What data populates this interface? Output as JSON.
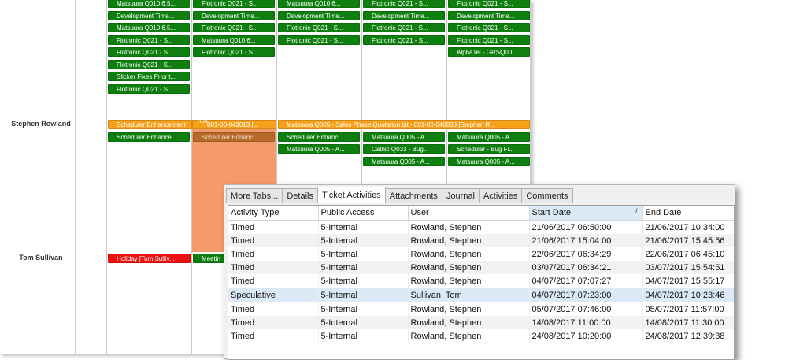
{
  "schedule": {
    "people": [
      {
        "name": "Stephen Rowland"
      },
      {
        "name": "Tom Sullivan"
      }
    ],
    "top_events": [
      {
        "col": 0,
        "row": 0,
        "text": "Matsuura Q010 6.5..."
      },
      {
        "col": 0,
        "row": 1,
        "text": "Development Time..."
      },
      {
        "col": 0,
        "row": 2,
        "text": "Matsuura Q010 6.5..."
      },
      {
        "col": 0,
        "row": 3,
        "text": "Flotronic Q021 - S..."
      },
      {
        "col": 0,
        "row": 4,
        "text": "Flotronic Q021 - S..."
      },
      {
        "col": 0,
        "row": 5,
        "text": "Flotronic Q021 - S..."
      },
      {
        "col": 0,
        "row": 6,
        "text": "Slicker Fixes Priorit..."
      },
      {
        "col": 0,
        "row": 7,
        "text": "Flotronic Q021 - S..."
      },
      {
        "col": 1,
        "row": 0,
        "text": "Flotronic Q021 - S..."
      },
      {
        "col": 1,
        "row": 1,
        "text": "Development Time..."
      },
      {
        "col": 1,
        "row": 2,
        "text": "Flotronic Q021 - S..."
      },
      {
        "col": 1,
        "row": 3,
        "text": "Matsuura Q010 6..."
      },
      {
        "col": 1,
        "row": 4,
        "text": "Flotronic Q021 - S..."
      },
      {
        "col": 2,
        "row": 0,
        "text": "Matsuura Q010 6..."
      },
      {
        "col": 2,
        "row": 1,
        "text": "Development Time..."
      },
      {
        "col": 2,
        "row": 2,
        "text": "Flotronic Q021 - S..."
      },
      {
        "col": 2,
        "row": 3,
        "text": "Flotronic Q021 - S..."
      },
      {
        "col": 3,
        "row": 0,
        "text": "Flotronic Q021 - S..."
      },
      {
        "col": 3,
        "row": 1,
        "text": "Development Time..."
      },
      {
        "col": 3,
        "row": 2,
        "text": "Flotronic Q021 - S..."
      },
      {
        "col": 3,
        "row": 3,
        "text": "Flotronic Q021 - S..."
      },
      {
        "col": 4,
        "row": 0,
        "text": "Flotronic Q021 - S..."
      },
      {
        "col": 4,
        "row": 1,
        "text": "Development Time..."
      },
      {
        "col": 4,
        "row": 2,
        "text": "Flotronic Q021 - S..."
      },
      {
        "col": 4,
        "row": 3,
        "text": "Flotronic Q021 - S..."
      },
      {
        "col": 4,
        "row": 4,
        "text": "AlphaTel - GRSQ00..."
      }
    ],
    "stephen_events": {
      "orange_left": "Scheduler Enhancement",
      "orange_marker": "7/04",
      "orange_mid": "001-00-042013 [...",
      "orange_right": "Matsuura Q005 - Sales Phase Quotation bit - 001-00-040838 [Stephen R...",
      "green": [
        {
          "col": 0,
          "row": 1,
          "text": "Scheduler Enhance..."
        },
        {
          "col": 1,
          "row": 1,
          "text": "Scheduler Enhanc...",
          "style": "brown"
        },
        {
          "col": 2,
          "row": 1,
          "text": "Scheduler Enhanc..."
        },
        {
          "col": 2,
          "row": 2,
          "text": "Matsuura Q005 - A..."
        },
        {
          "col": 3,
          "row": 1,
          "text": "Matsuura Q005 - A..."
        },
        {
          "col": 3,
          "row": 2,
          "text": "Catnic Q033 - Bug..."
        },
        {
          "col": 3,
          "row": 3,
          "text": "Matsuura Q005 - A..."
        },
        {
          "col": 4,
          "row": 1,
          "text": "Matsuura Q005 - A..."
        },
        {
          "col": 4,
          "row": 2,
          "text": "Scheduler - Bug Fi..."
        },
        {
          "col": 4,
          "row": 3,
          "text": "Matsuura Q005 - A..."
        }
      ]
    },
    "tom_events": {
      "holiday": "Holiday [Tom Sulliv...",
      "meeting": "Meetin"
    }
  },
  "panel": {
    "tabs": [
      "More Tabs...",
      "Details",
      "Ticket Activities",
      "Attachments",
      "Journal",
      "Activities",
      "Comments"
    ],
    "active_tab": 2,
    "sort_arrow": "/",
    "columns": [
      "Activity Type",
      "Public Access",
      "User",
      "Start Date",
      "End Date"
    ],
    "rows": [
      [
        "Timed",
        "5-Internal",
        "Rowland, Stephen",
        "21/06/2017 06:50:00",
        "21/06/2017 10:34:00"
      ],
      [
        "Timed",
        "5-Internal",
        "Rowland, Stephen",
        "21/06/2017 15:04:00",
        "21/06/2017 15:45:56"
      ],
      [
        "Timed",
        "5-Internal",
        "Rowland, Stephen",
        "22/06/2017 06:34:29",
        "22/06/2017 06:45:10"
      ],
      [
        "Timed",
        "5-Internal",
        "Rowland, Stephen",
        "03/07/2017 06:34:21",
        "03/07/2017 15:54:51"
      ],
      [
        "Timed",
        "5-Internal",
        "Rowland, Stephen",
        "04/07/2017 07:07:27",
        "04/07/2017 15:55:17"
      ],
      [
        "Speculative",
        "5-Internal",
        "Sullivan, Tom",
        "04/07/2017 07:23:00",
        "04/07/2017 10:23:46"
      ],
      [
        "Timed",
        "5-Internal",
        "Rowland, Stephen",
        "05/07/2017 07:46:00",
        "05/07/2017 11:57:00"
      ],
      [
        "Timed",
        "5-Internal",
        "Rowland, Stephen",
        "14/08/2017 11:00:00",
        "14/08/2017 11:30:00"
      ],
      [
        "Timed",
        "5-Internal",
        "Rowland, Stephen",
        "24/08/2017 10:20:00",
        "24/08/2017 12:39:38"
      ]
    ],
    "selected_row": 5,
    "colors": {
      "selected": "#dceaf7",
      "event_green": "#0e7f0e",
      "event_orange": "#f7a11a",
      "holiday_red": "#ee1111"
    }
  }
}
